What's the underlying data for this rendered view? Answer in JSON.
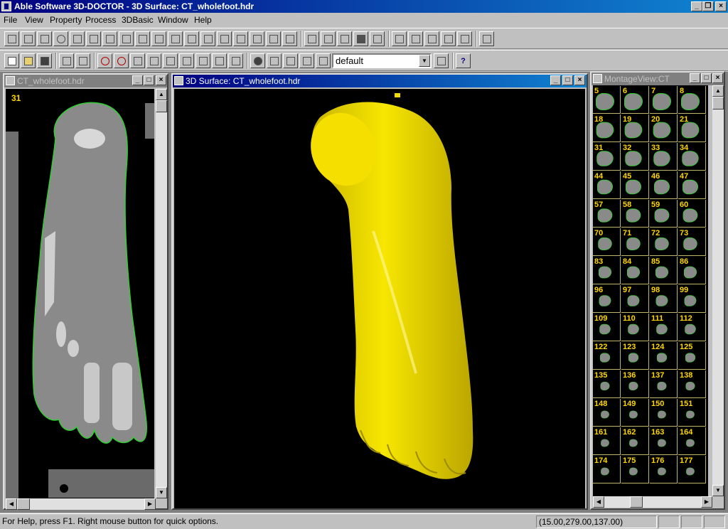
{
  "app": {
    "title": "Able Software 3D-DOCTOR - 3D Surface: CT_wholefoot.hdr"
  },
  "menu": {
    "items": [
      "File",
      "View",
      "Property",
      "Process",
      "3DBasic",
      "Window",
      "Help"
    ]
  },
  "toolbar2": {
    "preset": "default"
  },
  "windows": {
    "slice": {
      "title": "CT_wholefoot.hdr",
      "slice_number": "31"
    },
    "surface": {
      "title": "3D Surface: CT_wholefoot.hdr"
    },
    "montage": {
      "title": "MontageView:CT",
      "labels": [
        [
          "5",
          "6",
          "7",
          "8"
        ],
        [
          "18",
          "19",
          "20",
          "21"
        ],
        [
          "31",
          "32",
          "33",
          "34"
        ],
        [
          "44",
          "45",
          "46",
          "47"
        ],
        [
          "57",
          "58",
          "59",
          "60"
        ],
        [
          "70",
          "71",
          "72",
          "73"
        ],
        [
          "83",
          "84",
          "85",
          "86"
        ],
        [
          "96",
          "97",
          "98",
          "99"
        ],
        [
          "109",
          "110",
          "111",
          "112"
        ],
        [
          "122",
          "123",
          "124",
          "125"
        ],
        [
          "135",
          "136",
          "137",
          "138"
        ],
        [
          "148",
          "149",
          "150",
          "151"
        ],
        [
          "161",
          "162",
          "163",
          "164"
        ],
        [
          "174",
          "175",
          "176",
          "177"
        ]
      ]
    }
  },
  "status": {
    "help": "For Help, press F1. Right mouse button for quick options.",
    "coords": "(15.00,279.00,137.00)"
  },
  "colors": {
    "surface": "#f2dc00",
    "contour": "#30d030",
    "label": "#ffd700"
  }
}
